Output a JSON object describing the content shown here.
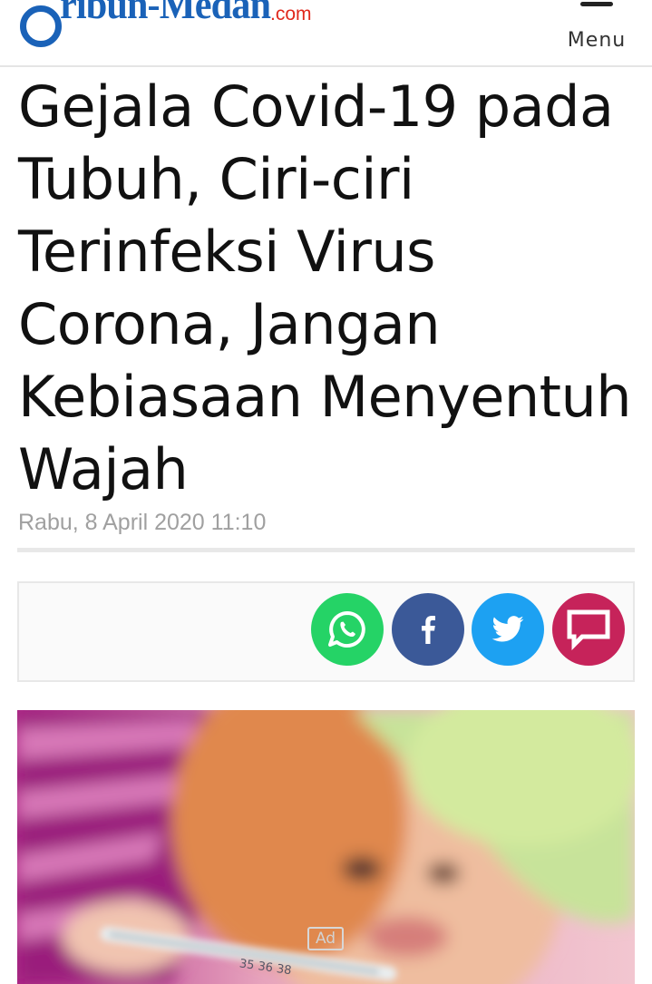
{
  "header": {
    "logo_text": "ribun-Medan",
    "logo_tld": ".com",
    "menu_label": "Menu"
  },
  "article": {
    "title": "Gejala Covid-19 pada Tubuh, Ciri-ciri Terinfeksi Virus Corona, Jangan Kebiasaan Menyentuh Wajah",
    "date": "Rabu, 8 April 2020 11:10"
  },
  "share": {
    "buttons": [
      {
        "name": "whatsapp",
        "icon": "whatsapp-icon",
        "color": "#25d366"
      },
      {
        "name": "facebook",
        "icon": "facebook-icon",
        "color": "#3b5998"
      },
      {
        "name": "twitter",
        "icon": "twitter-icon",
        "color": "#1da1f2"
      },
      {
        "name": "comment",
        "icon": "comment-icon",
        "color": "#c6235a"
      }
    ]
  },
  "ad": {
    "label": "Ad"
  },
  "colors": {
    "brand_blue": "#1a62b8",
    "brand_red": "#e0281c",
    "date_gray": "#a0a0a0"
  }
}
